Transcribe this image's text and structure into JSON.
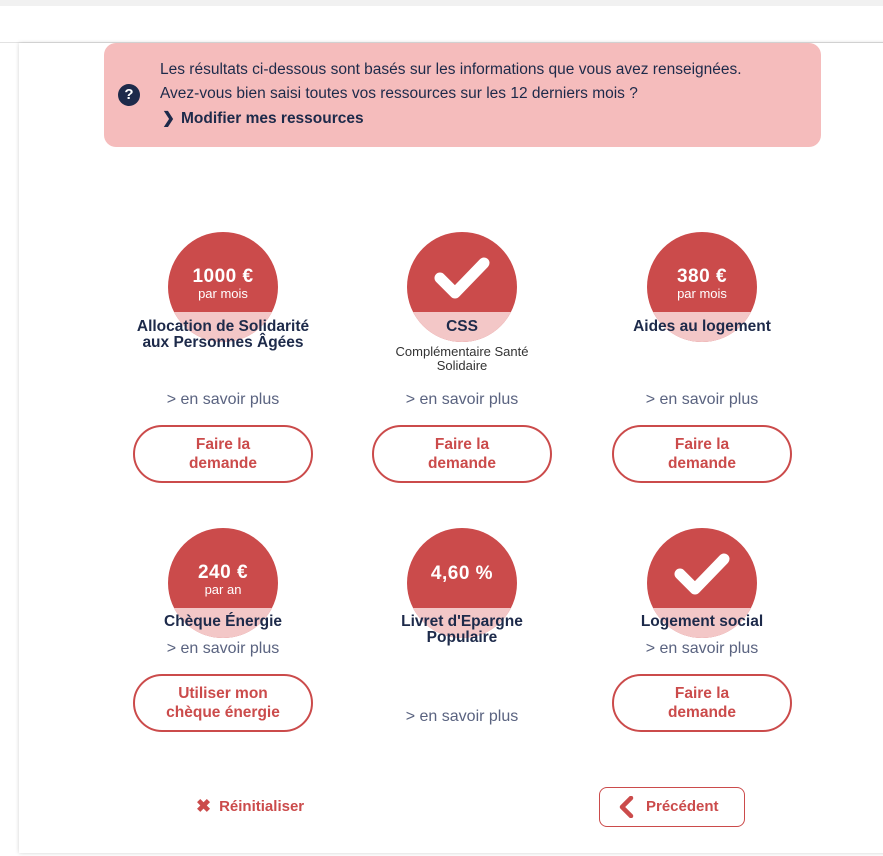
{
  "alert": {
    "line1": "Les résultats ci-dessous sont basés sur les informations que vous avez renseignées.",
    "line2": "Avez-vous bien saisi toutes vos ressources sur les 12 derniers mois ?",
    "link_label": "Modifier mes ressources",
    "icon": "question-circle-icon"
  },
  "tiles": [
    {
      "value": "1000 €",
      "unit": "par mois",
      "title": "Allocation de Solidarité aux Personnes Âgées",
      "title_line1": "Allocation de Solidarité",
      "title_line2": "aux Personnes Âgées",
      "more": "> en savoir plus",
      "action_line1": "Faire la",
      "action_line2": "demande"
    },
    {
      "icon": "check-icon",
      "title": "CSS",
      "subtitle_line1": "Complémentaire Santé",
      "subtitle_line2": "Solidaire",
      "more": "> en savoir plus",
      "action_line1": "Faire la",
      "action_line2": "demande"
    },
    {
      "value": "380 €",
      "unit": "par mois",
      "title": "Aides au logement",
      "more": "> en savoir plus",
      "action_line1": "Faire la",
      "action_line2": "demande"
    },
    {
      "value": "240 €",
      "unit": "par an",
      "title": "Chèque Énergie",
      "more": "> en savoir plus",
      "action_line1": "Utiliser mon",
      "action_line2": "chèque énergie"
    },
    {
      "value": "4,60 %",
      "title_line1": "Livret d'Epargne",
      "title_line2": "Populaire",
      "more": "> en savoir plus"
    },
    {
      "icon": "check-icon",
      "title": "Logement social",
      "more": "> en savoir plus",
      "action_line1": "Faire la",
      "action_line2": "demande"
    }
  ],
  "footer": {
    "reset_label": "Réinitialiser",
    "previous_label": "Précédent"
  },
  "colors": {
    "accent": "#cb4b4b",
    "accent_light": "#f3c7c7",
    "alert_bg": "#f5bcbc",
    "navy": "#1d2a4a"
  }
}
